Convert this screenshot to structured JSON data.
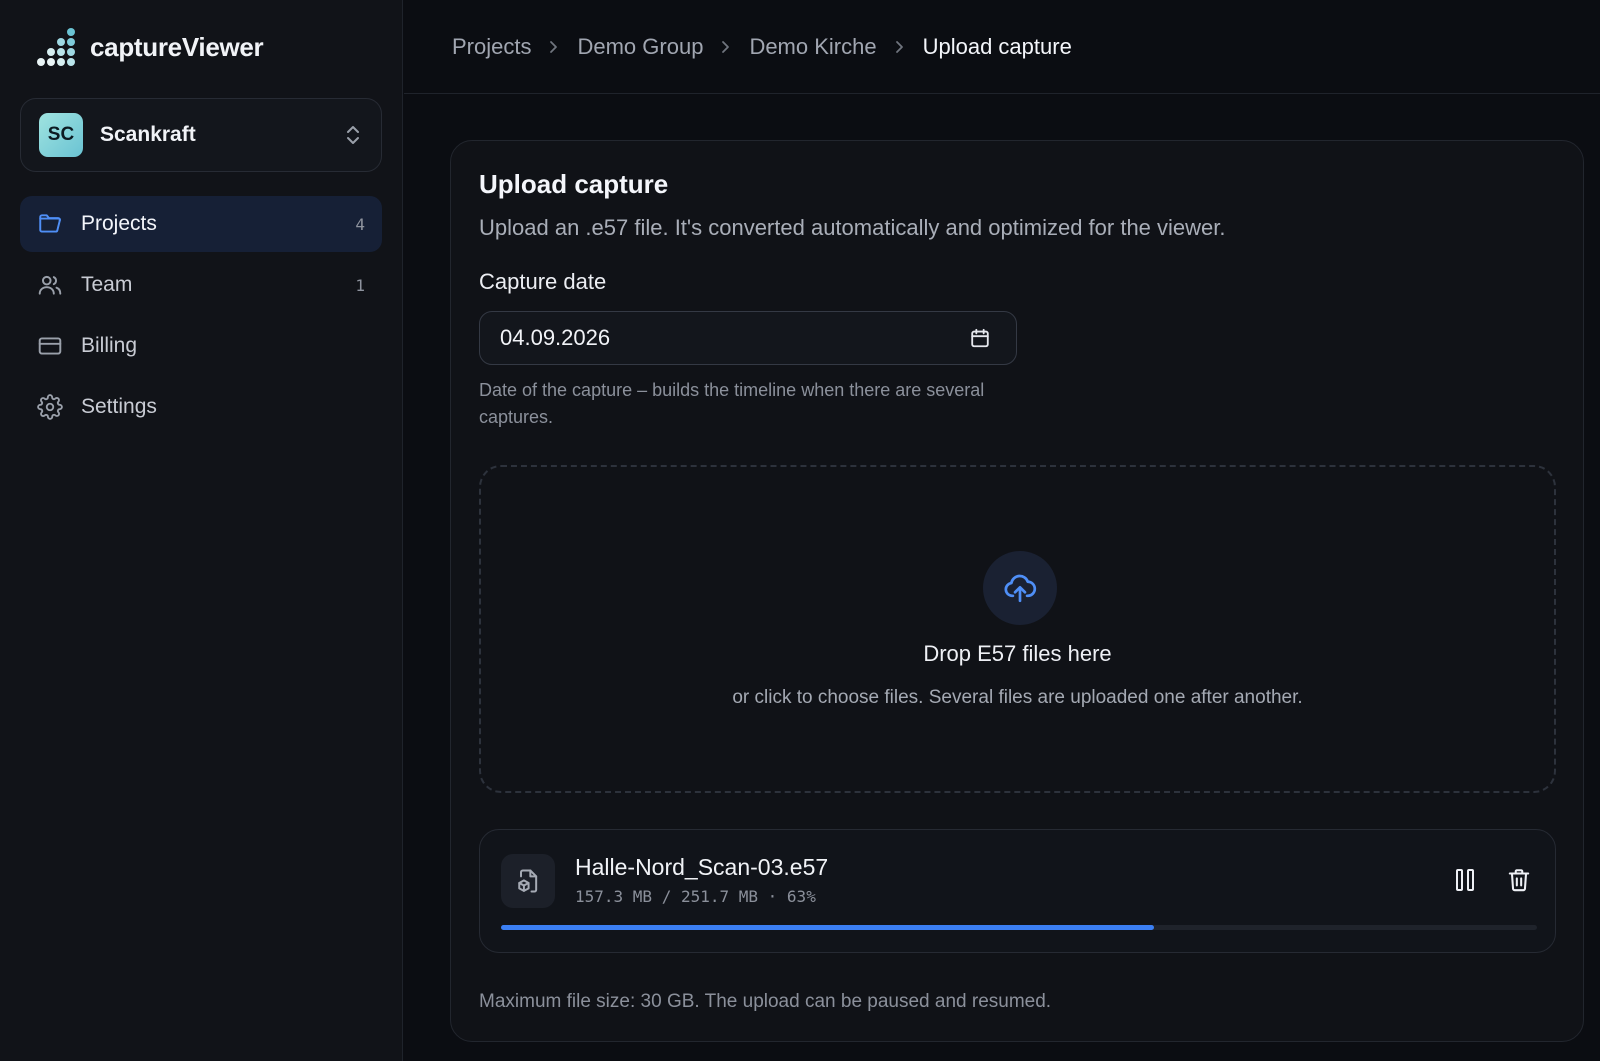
{
  "app": {
    "name": "captureViewer",
    "logo_icon": "dot-grid-logo"
  },
  "org": {
    "initials": "SC",
    "name": "Scankraft"
  },
  "nav": [
    {
      "label": "Projects",
      "count": "4",
      "icon": "folder-icon",
      "active": true
    },
    {
      "label": "Team",
      "count": "1",
      "icon": "users-icon",
      "active": false
    },
    {
      "label": "Billing",
      "count": "",
      "icon": "credit-card-icon",
      "active": false
    },
    {
      "label": "Settings",
      "count": "",
      "icon": "gear-icon",
      "active": false
    }
  ],
  "breadcrumb": [
    "Projects",
    "Demo Group",
    "Demo Kirche",
    "Upload capture"
  ],
  "upload": {
    "title": "Upload capture",
    "subtitle": "Upload an .e57 file. It's converted automatically and optimized for the viewer.",
    "date_label": "Capture date",
    "date_value": "04.09.2026",
    "date_hint": "Date of the capture – builds the timeline when there are several captures.",
    "drop_title": "Drop E57 files here",
    "drop_subtitle": "or click to choose files. Several files are uploaded one after another.",
    "footer": "Maximum file size: 30 GB. The upload can be paused and resumed."
  },
  "file": {
    "name": "Halle-Nord_Scan-03.e57",
    "meta": "157.3 MB / 251.7 MB · 63%",
    "progress": 0.63
  },
  "colors": {
    "accent": "#3b7ff3",
    "background": "#0b0d12",
    "sidebar": "#111318"
  }
}
